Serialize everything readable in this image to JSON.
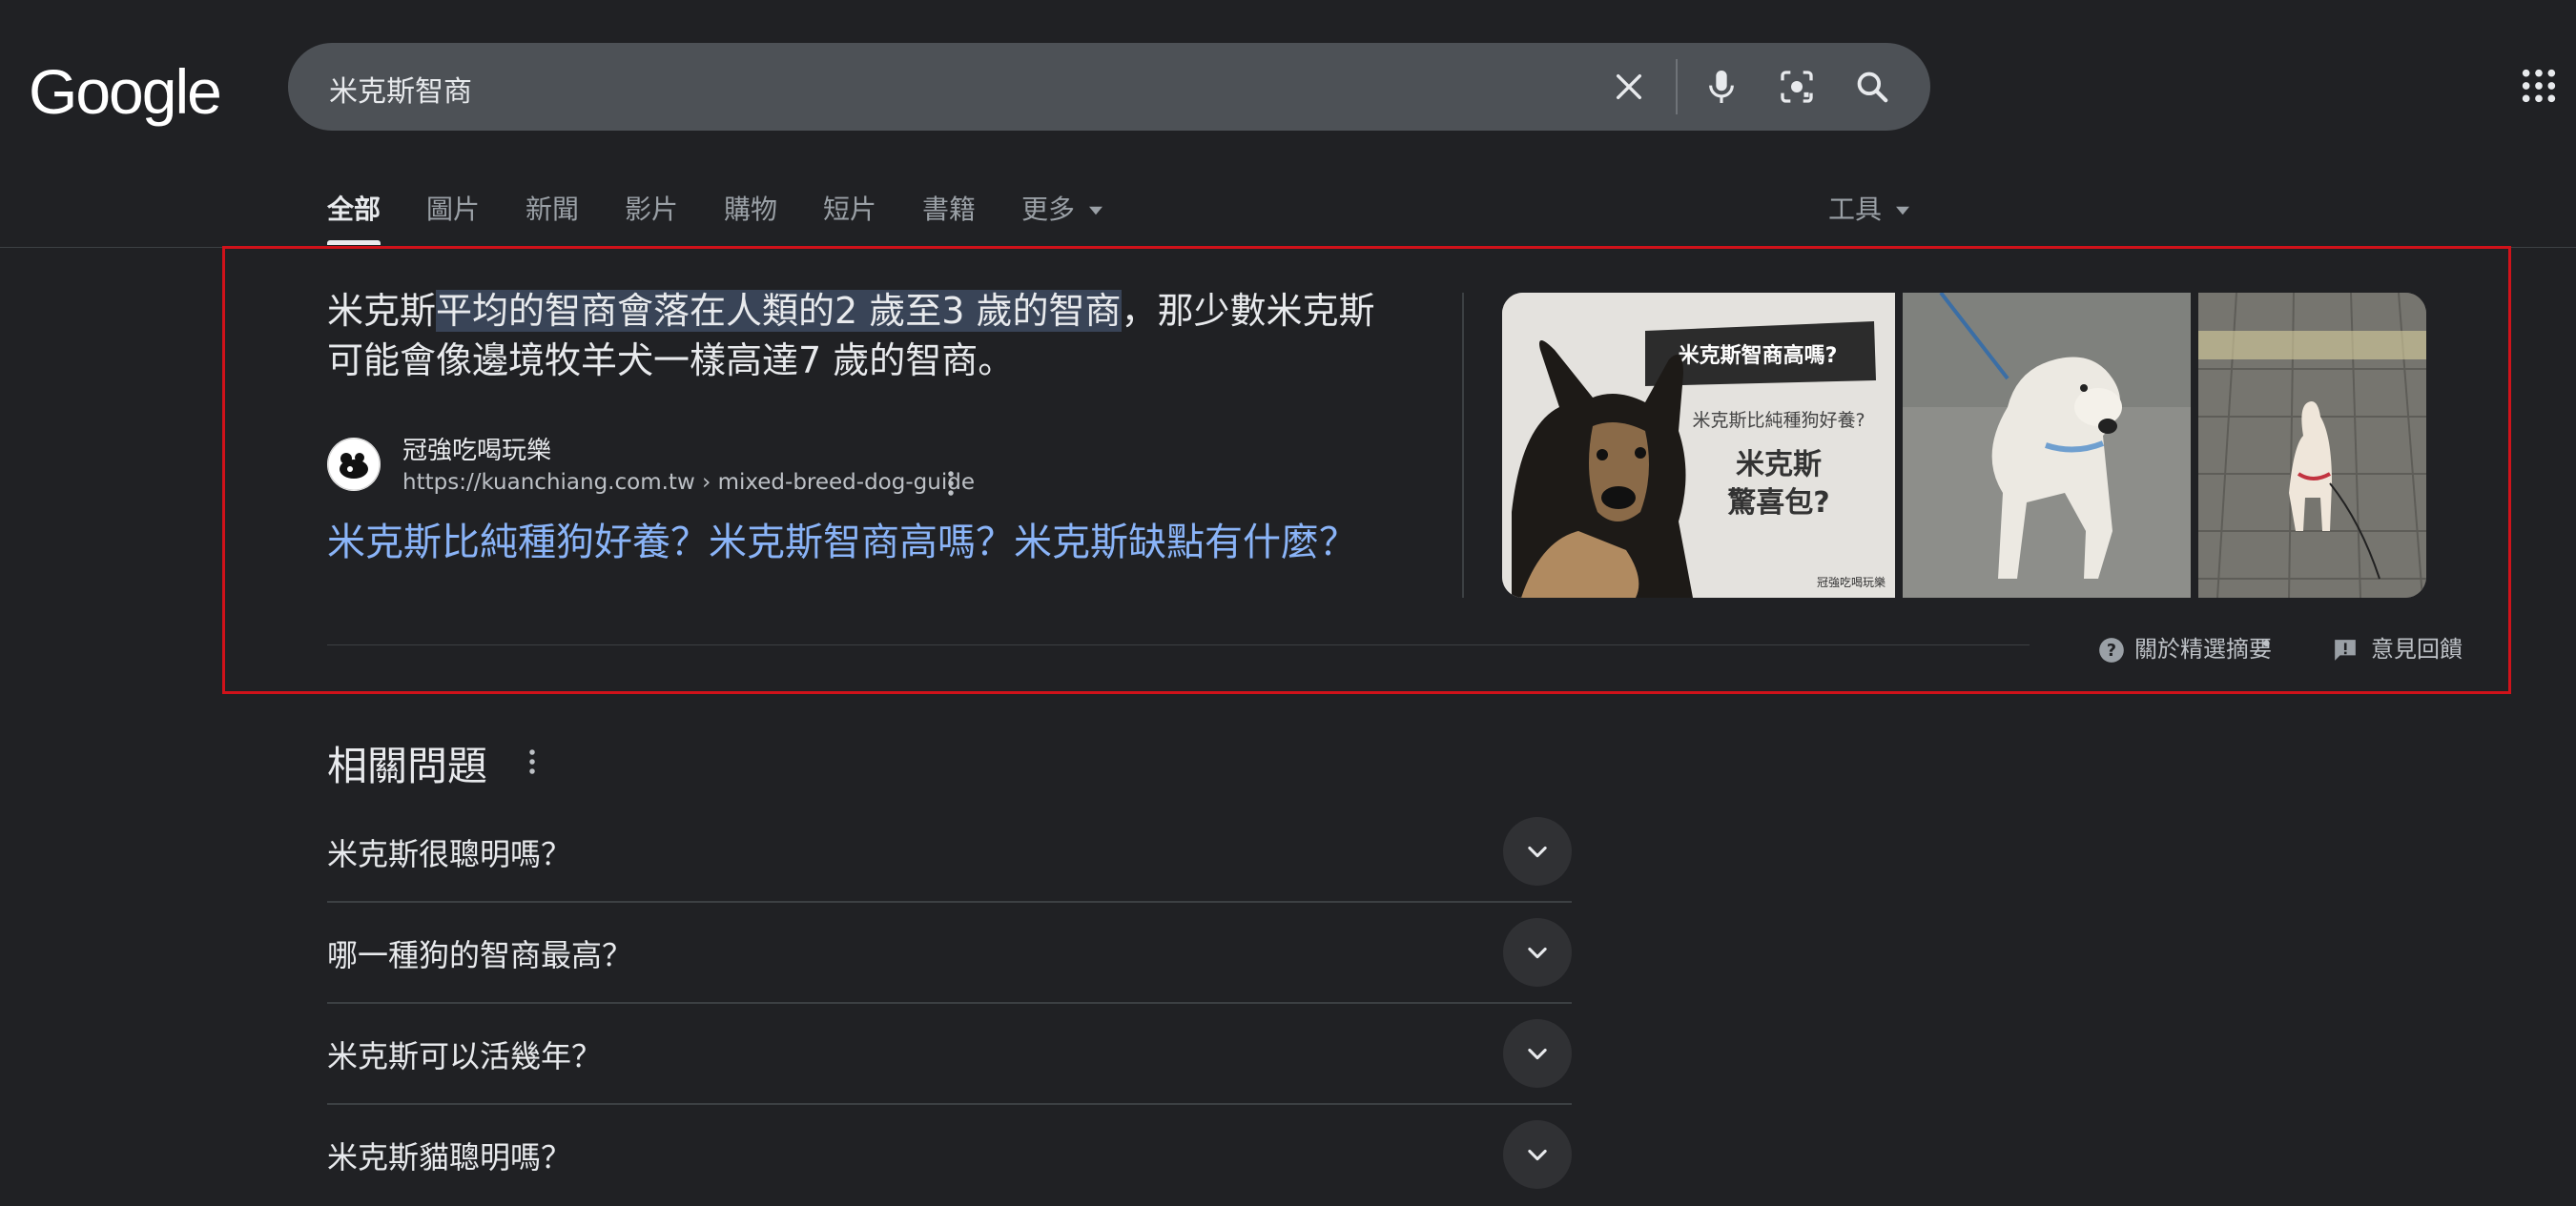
{
  "header": {
    "logo": "Google",
    "query": "米克斯智商",
    "icons": [
      "clear-icon",
      "microphone-icon",
      "camera-lens-icon",
      "search-icon",
      "apps-grid-icon"
    ]
  },
  "tabs": [
    {
      "label": "全部",
      "active": true
    },
    {
      "label": "圖片"
    },
    {
      "label": "新聞"
    },
    {
      "label": "影片"
    },
    {
      "label": "購物"
    },
    {
      "label": "短片"
    },
    {
      "label": "書籍"
    },
    {
      "label": "更多"
    }
  ],
  "tools_label": "工具",
  "snippet": {
    "answer_pre": "米克斯",
    "answer_highlight": "平均的智商會落在人類的2 歲至3 歲的智商",
    "answer_post": "，那少數米克斯可能會像邊境牧羊犬一樣高達7 歲的智商。",
    "source_name": "冠強吃喝玩樂",
    "source_url": "https://kuanchiang.com.tw › mixed-breed-dog-guide",
    "result_title": "米克斯比純種狗好養？米克斯智商高嗎？米克斯缺點有什麼？",
    "image_text": {
      "banner": "米克斯智商高嗎?",
      "line1": "米克斯比純種狗好養?",
      "line2a": "米克斯",
      "line2b": "驚喜包?",
      "watermark": "冠強吃喝玩樂"
    },
    "about_label": "關於精選摘要",
    "separator": "•",
    "feedback_label": "意見回饋"
  },
  "related": {
    "title": "相關問題",
    "questions": [
      "米克斯很聰明嗎？",
      "哪一種狗的智商最高？",
      "米克斯可以活幾年？",
      "米克斯貓聰明嗎？"
    ]
  },
  "colors": {
    "background": "#202124",
    "link": "#8ab4f8",
    "highlight": "#394457",
    "annotation_box": "#d0121a"
  }
}
